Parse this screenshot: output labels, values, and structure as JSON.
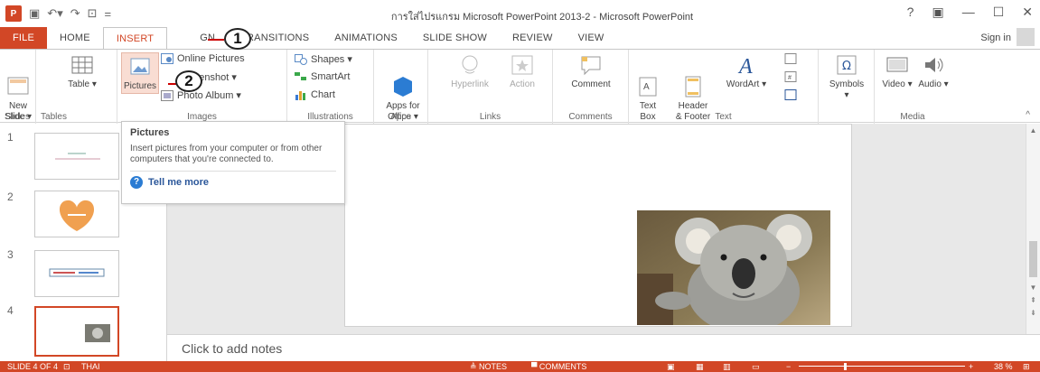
{
  "app": {
    "logo_text": "P",
    "window_title": "การใส่ไปรแกรม Microsoft PowerPoint 2013-2 - Microsoft PowerPoint",
    "win_controls": [
      "?",
      "▣",
      "—",
      "☐",
      "✕"
    ],
    "sign_in": "Sign in"
  },
  "tabs": [
    "FILE",
    "HOME",
    "INSERT",
    "DESIGN",
    "TRANSITIONS",
    "ANIMATIONS",
    "SLIDE SHOW",
    "REVIEW",
    "VIEW"
  ],
  "tab_labels": {
    "file": "FILE",
    "home": "HOME",
    "insert": "INSERT",
    "design": "GN",
    "transitions": "TRANSITIONS",
    "animations": "ANIMATIONS",
    "slideshow": "SLIDE SHOW",
    "review": "REVIEW",
    "view": "VIEW"
  },
  "ribbon": {
    "slides": {
      "label": "Slides",
      "new_slide": "New\nSlide ▾"
    },
    "tables": {
      "label": "Tables",
      "table": "Table ▾"
    },
    "images": {
      "label": "Images",
      "pictures": "Pictures",
      "online_pictures": "Online Pictures",
      "screenshot": "creenshot ▾",
      "photo_album": "Photo Album ▾"
    },
    "illustrations": {
      "label": "Illustrations",
      "shapes": "Shapes ▾",
      "smartart": "SmartArt",
      "chart": "Chart"
    },
    "apps": {
      "label": "Apps",
      "apps_for_office": "Apps for\nOffice ▾"
    },
    "links": {
      "label": "Links",
      "hyperlink": "Hyperlink",
      "action": "Action"
    },
    "comments": {
      "label": "Comments",
      "comment": "Comment"
    },
    "text": {
      "label": "Text",
      "text_box": "Text\nBox",
      "header_footer": "Header\n& Footer",
      "wordart": "WordArt ▾"
    },
    "symbols": {
      "label": "",
      "symbols": "Symbols ▾"
    },
    "media": {
      "label": "Media",
      "video": "Video ▾",
      "audio": "Audio ▾"
    }
  },
  "callouts": {
    "one": "1",
    "two": "2"
  },
  "tooltip": {
    "title": "Pictures",
    "body": "Insert pictures from your computer or from other computers that you're connected to.",
    "link": "Tell me more"
  },
  "thumbnails": [
    {
      "num": "1",
      "caption": ""
    },
    {
      "num": "2",
      "caption": ""
    },
    {
      "num": "3",
      "caption": ""
    },
    {
      "num": "4",
      "caption": ""
    }
  ],
  "notes_placeholder": "Click to add notes",
  "status": {
    "slide_of": "SLIDE 4 OF 4",
    "language": "THAI",
    "notes": "≜ NOTES",
    "comments": "▀ COMMENTS",
    "zoom": "38 %"
  },
  "colors": {
    "accent": "#d24726",
    "link_blue": "#2b579a"
  }
}
